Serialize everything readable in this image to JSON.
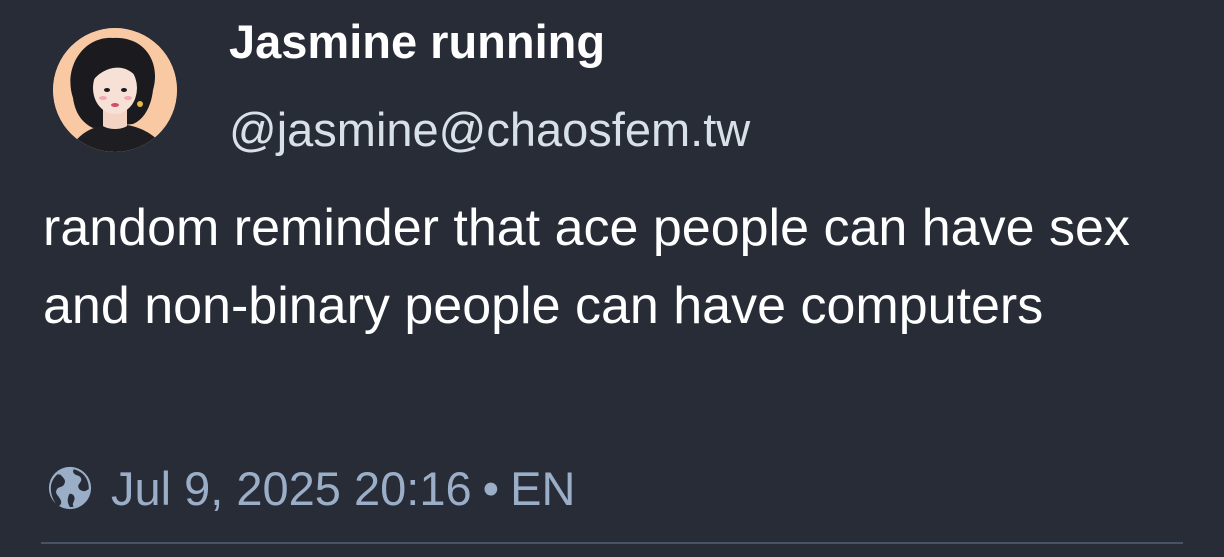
{
  "author": {
    "display_name": "Jasmine running",
    "handle": "@jasmine@chaosfem.tw",
    "avatar_icon": "avatar-illustration"
  },
  "post": {
    "text": "random reminder that ace people can have sex and non-binary people can have computers"
  },
  "meta": {
    "visibility_icon": "globe-icon",
    "timestamp": "Jul 9, 2025 20:16",
    "separator": "•",
    "language": "EN"
  },
  "colors": {
    "background": "#282c37",
    "text_primary": "#ffffff",
    "text_secondary": "#d9e1e8",
    "meta_text": "#9baec8",
    "divider": "#4a5266",
    "avatar_background": "#f8c9a6"
  }
}
